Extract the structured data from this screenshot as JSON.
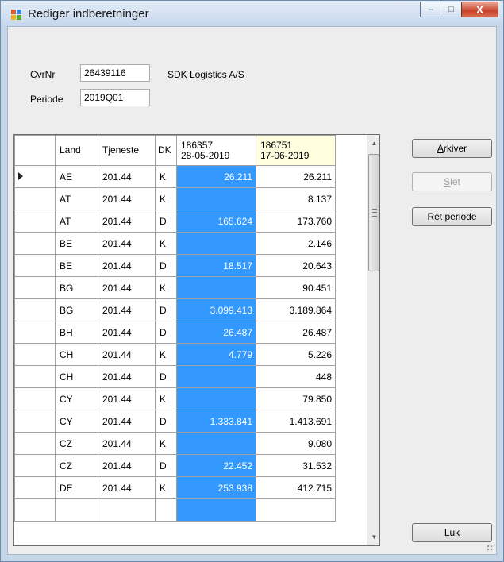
{
  "window": {
    "title": "Rediger indberetninger",
    "minimize_glyph": "–",
    "maximize_glyph": "□",
    "close_glyph": "X"
  },
  "form": {
    "cvr_label": "CvrNr",
    "cvr_value": "26439116",
    "company_name": "SDK Logistics A/S",
    "period_label": "Periode",
    "period_value": "2019Q01"
  },
  "grid": {
    "headers": [
      "Land",
      "Tjeneste",
      "DK"
    ],
    "col4_header": [
      "186357",
      "28-05-2019"
    ],
    "col5_header": [
      "186751",
      "17-06-2019"
    ],
    "rows": [
      [
        "AE",
        "201.44",
        "K",
        "26.211",
        "26.211"
      ],
      [
        "AT",
        "201.44",
        "K",
        "",
        "8.137"
      ],
      [
        "AT",
        "201.44",
        "D",
        "165.624",
        "173.760"
      ],
      [
        "BE",
        "201.44",
        "K",
        "",
        "2.146"
      ],
      [
        "BE",
        "201.44",
        "D",
        "18.517",
        "20.643"
      ],
      [
        "BG",
        "201.44",
        "K",
        "",
        "90.451"
      ],
      [
        "BG",
        "201.44",
        "D",
        "3.099.413",
        "3.189.864"
      ],
      [
        "BH",
        "201.44",
        "D",
        "26.487",
        "26.487"
      ],
      [
        "CH",
        "201.44",
        "K",
        "4.779",
        "5.226"
      ],
      [
        "CH",
        "201.44",
        "D",
        "",
        "448"
      ],
      [
        "CY",
        "201.44",
        "K",
        "",
        "79.850"
      ],
      [
        "CY",
        "201.44",
        "D",
        "1.333.841",
        "1.413.691"
      ],
      [
        "CZ",
        "201.44",
        "K",
        "",
        "9.080"
      ],
      [
        "CZ",
        "201.44",
        "D",
        "22.452",
        "31.532"
      ],
      [
        "DE",
        "201.44",
        "K",
        "253.938",
        "412.715"
      ]
    ],
    "current_row": 0,
    "selection_color": "#3399ff"
  },
  "buttons": {
    "archive": {
      "mnemonic": "A",
      "rest": "rkiver"
    },
    "delete": {
      "mnemonic": "S",
      "rest": "let"
    },
    "fix_period": {
      "prefix": "Ret ",
      "mnemonic": "p",
      "rest": "eriode"
    },
    "close": {
      "mnemonic": "L",
      "rest": "uk"
    }
  }
}
